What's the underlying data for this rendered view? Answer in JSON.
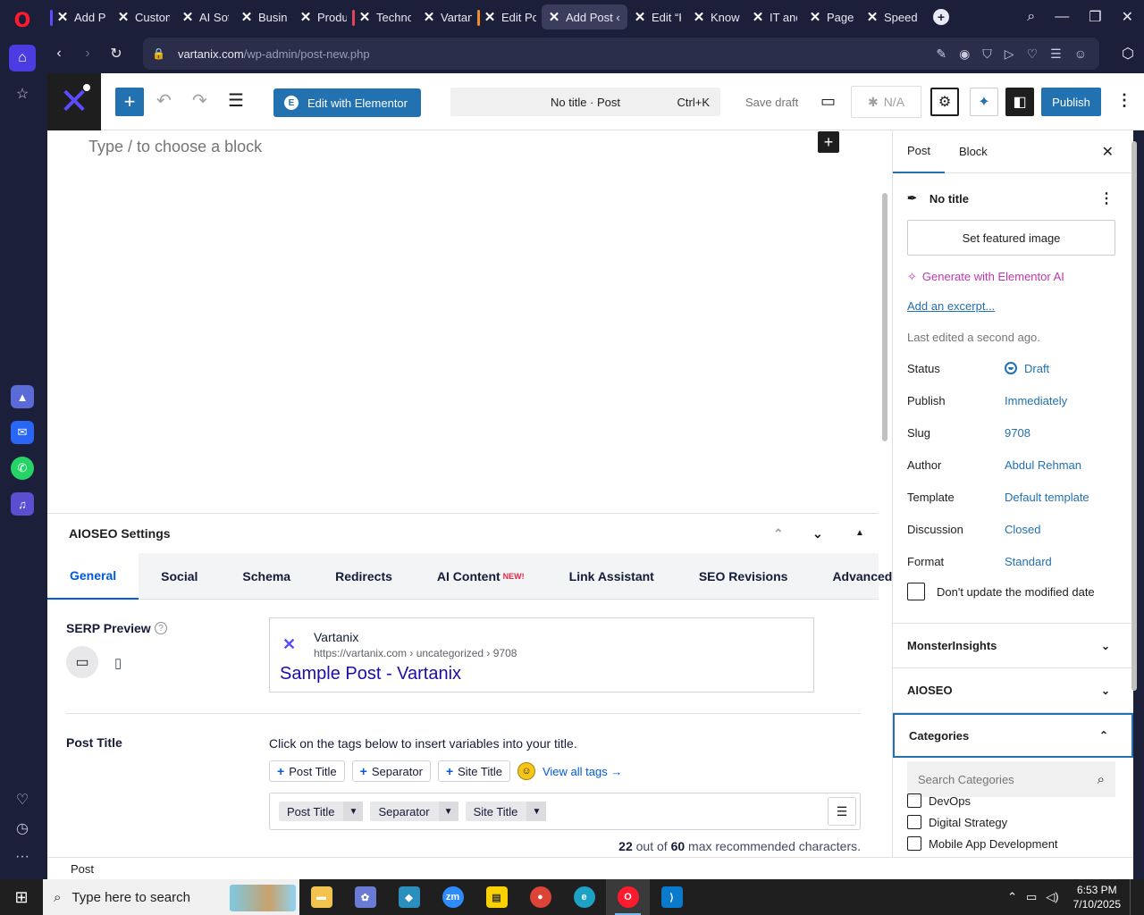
{
  "browser": {
    "tabs": [
      {
        "label": "Add Po",
        "bar": "#5b4cff"
      },
      {
        "label": "Custom"
      },
      {
        "label": "AI Soft"
      },
      {
        "label": "Busine"
      },
      {
        "label": "Produc"
      },
      {
        "label": "Techno",
        "bar": "#e0455a"
      },
      {
        "label": "Vartani"
      },
      {
        "label": "Edit Po",
        "bar": "#f28c28"
      },
      {
        "label": "Add Post ‹ V",
        "active": true
      },
      {
        "label": "Edit “K"
      },
      {
        "label": "Knowle"
      },
      {
        "label": "IT and"
      },
      {
        "label": "Pages"
      },
      {
        "label": "Speed"
      }
    ],
    "url_host": "vartanix.com",
    "url_path": "/wp-admin/post-new.php"
  },
  "editor": {
    "elementor_label": "Edit with Elementor",
    "doc_title": "No title · Post",
    "shortcut": "Ctrl+K",
    "save_draft": "Save draft",
    "na_label": "N/A",
    "publish": "Publish",
    "block_placeholder": "Type / to choose a block",
    "footer": "Post"
  },
  "aioseo": {
    "title": "AIOSEO Settings",
    "tabs": [
      "General",
      "Social",
      "Schema",
      "Redirects",
      "AI Content",
      "Link Assistant",
      "SEO Revisions",
      "Advanced"
    ],
    "new_badge": "NEW!",
    "serp_label": "SERP Preview",
    "serp_site": "Vartanix",
    "serp_url": "https://vartanix.com › uncategorized › 9708",
    "serp_title": "Sample Post - Vartanix",
    "post_title_label": "Post Title",
    "post_title_hint": "Click on the tags below to insert variables into your title.",
    "tags": [
      "Post Title",
      "Separator",
      "Site Title"
    ],
    "view_all": "View all tags →",
    "tokens": [
      "Post Title",
      "Separator",
      "Site Title"
    ],
    "char_used": "22",
    "char_mid": "out of",
    "char_max": "60",
    "char_tail": "max recommended characters."
  },
  "sidebar": {
    "tab_post": "Post",
    "tab_block": "Block",
    "post_title": "No title",
    "featured": "Set featured image",
    "gen_ai": "Generate with Elementor AI",
    "excerpt": "Add an excerpt...",
    "last_edited": "Last edited a second ago.",
    "meta": [
      {
        "k": "Status",
        "v": "Draft"
      },
      {
        "k": "Publish",
        "v": "Immediately"
      },
      {
        "k": "Slug",
        "v": "9708"
      },
      {
        "k": "Author",
        "v": "Abdul Rehman"
      },
      {
        "k": "Template",
        "v": "Default template"
      },
      {
        "k": "Discussion",
        "v": "Closed"
      },
      {
        "k": "Format",
        "v": "Standard"
      }
    ],
    "dont_update": "Don't update the modified date",
    "panels": [
      "MonsterInsights",
      "AIOSEO",
      "Categories"
    ],
    "cat_search": "Search Categories",
    "categories": [
      "DevOps",
      "Digital Strategy",
      "Mobile App Development"
    ]
  },
  "taskbar": {
    "search": "Type here to search",
    "time": "6:53 PM",
    "date": "7/10/2025"
  }
}
